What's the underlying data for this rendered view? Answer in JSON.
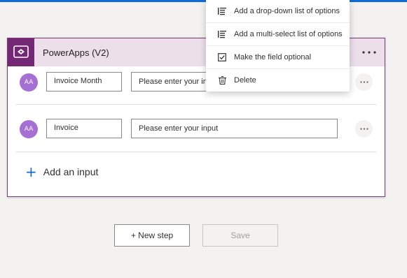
{
  "card": {
    "title": "PowerApps (V2)",
    "icon": "powerapps-icon",
    "inputs": [
      {
        "avatar": "AA",
        "name": "Invoice Month",
        "hint": "Please enter your input"
      },
      {
        "avatar": "AA",
        "name": "Invoice",
        "hint": "Please enter your input"
      }
    ],
    "add_input_label": "Add an input"
  },
  "buttons": {
    "new_step": "+ New step",
    "save": "Save"
  },
  "menu": {
    "items": [
      {
        "label": "Add a drop-down list of options",
        "icon": "list-icon"
      },
      {
        "label": "Add a multi-select list of options",
        "icon": "list-icon"
      },
      {
        "label": "Make the field optional",
        "icon": "checkbox-icon"
      },
      {
        "label": "Delete",
        "icon": "trash-icon"
      }
    ]
  },
  "colors": {
    "accent": "#0f6cdb",
    "powerapps_purple": "#742774",
    "header_bg": "#ecdfea",
    "avatar": "#a56fd4"
  }
}
